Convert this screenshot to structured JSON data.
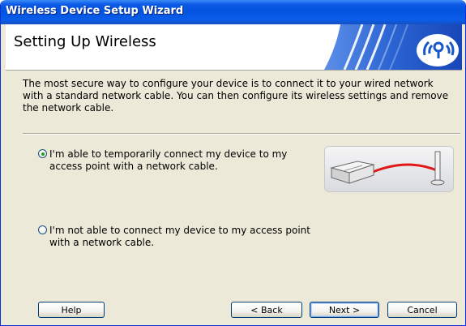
{
  "window": {
    "title": "Wireless Device Setup Wizard"
  },
  "header": {
    "title": "Setting Up Wireless"
  },
  "intro_text": "The most secure way to configure your device is to connect it to your wired network with a standard network cable. You can then configure its wireless settings and remove the network cable.",
  "options": [
    {
      "label": "I'm able to temporarily connect my device to my access point with a network cable.",
      "selected": true
    },
    {
      "label": "I'm not able to connect my device to my access point with a network cable.",
      "selected": false
    }
  ],
  "buttons": {
    "help": "Help",
    "back": "< Back",
    "next": "Next >",
    "cancel": "Cancel"
  },
  "colors": {
    "title_bar": "#0353df",
    "banner_accent": "#1a55c9",
    "window_bg": "#ece9d8",
    "cable": "#e01818"
  },
  "icons": {
    "banner": "wireless-signal-icon",
    "illustration": "printer-cable-access-point-icon"
  }
}
